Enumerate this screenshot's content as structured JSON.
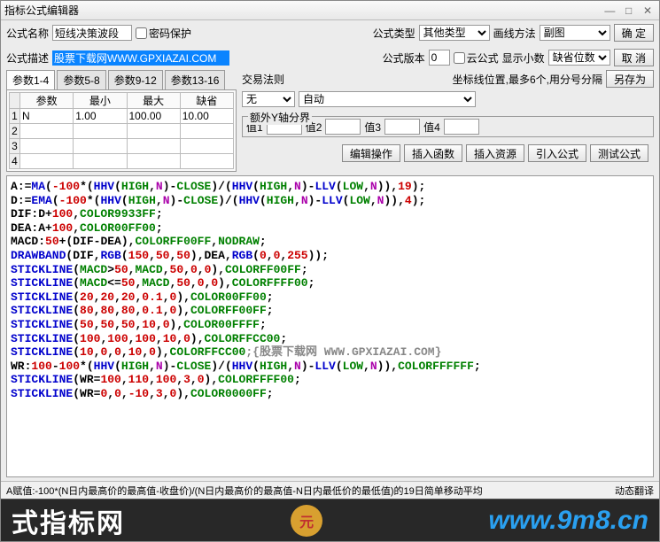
{
  "title": "指标公式编辑器",
  "labels": {
    "name": "公式名称",
    "password": "密码保护",
    "type": "公式类型",
    "drawmethod": "画线方法",
    "ok": "确  定",
    "desc": "公式描述",
    "version": "公式版本",
    "cloud": "云公式",
    "showdec": "显示小数",
    "cancel": "取  消",
    "saveas": "另存为"
  },
  "form": {
    "name_value": "短线决策波段",
    "desc_value": "股票下载网WWW.GPXIAZAI.COM",
    "type_value": "其他类型",
    "drawmethod_value": "副图",
    "version_value": "0",
    "showdec_value": "缺省位数"
  },
  "tabs": {
    "t1": "参数1-4",
    "t2": "参数5-8",
    "t3": "参数9-12",
    "t4": "参数13-16"
  },
  "paramhead": {
    "c1": "参数",
    "c2": "最小",
    "c3": "最大",
    "c4": "缺省"
  },
  "paramrows": [
    {
      "n": "1",
      "name": "N",
      "min": "1.00",
      "max": "100.00",
      "def": "10.00"
    },
    {
      "n": "2",
      "name": "",
      "min": "",
      "max": "",
      "def": ""
    },
    {
      "n": "3",
      "name": "",
      "min": "",
      "max": "",
      "def": ""
    },
    {
      "n": "4",
      "name": "",
      "min": "",
      "max": "",
      "def": ""
    }
  ],
  "right": {
    "tradelaw": "交易法则",
    "coordnote": "坐标线位置,最多6个,用分号分隔",
    "tradelaw_val": "无",
    "auto_val": "自动",
    "extraaxis": "额外Y轴分界",
    "v1": "值1",
    "v2": "值2",
    "v3": "值3",
    "v4": "值4"
  },
  "btns": {
    "edit": "编辑操作",
    "insfunc": "插入函数",
    "insres": "插入资源",
    "import": "引入公式",
    "test": "测试公式"
  },
  "status": {
    "left": "A赋值:-100*(N日内最高价的最高值-收盘价)/(N日内最高价的最高值-N日内最低价的最低值)的19日简单移动平均",
    "right": "动态翻译"
  },
  "watermark": {
    "left": "式指标网",
    "url": "www.9m8.cn"
  },
  "code": [
    [
      [
        "A",
        ""
      ],
      [
        ":=",
        ""
      ],
      [
        "MA",
        "blue"
      ],
      [
        "(",
        ""
      ],
      [
        "-100",
        "red"
      ],
      [
        "*(",
        ""
      ],
      [
        "HHV",
        "blue"
      ],
      [
        "(",
        ""
      ],
      [
        "HIGH",
        "green"
      ],
      [
        ",",
        ""
      ],
      [
        "N",
        "mag"
      ],
      [
        ")-",
        ""
      ],
      [
        "CLOSE",
        "green"
      ],
      [
        ")/(",
        ""
      ],
      [
        "HHV",
        "blue"
      ],
      [
        "(",
        ""
      ],
      [
        "HIGH",
        "green"
      ],
      [
        ",",
        ""
      ],
      [
        "N",
        "mag"
      ],
      [
        ")-",
        ""
      ],
      [
        "LLV",
        "blue"
      ],
      [
        "(",
        ""
      ],
      [
        "LOW",
        "green"
      ],
      [
        ",",
        ""
      ],
      [
        "N",
        "mag"
      ],
      [
        ")),",
        ""
      ],
      [
        "19",
        "red"
      ],
      [
        ");",
        ""
      ]
    ],
    [
      [
        "D",
        ""
      ],
      [
        ":=",
        ""
      ],
      [
        "EMA",
        "blue"
      ],
      [
        "(",
        ""
      ],
      [
        "-100",
        "red"
      ],
      [
        "*(",
        ""
      ],
      [
        "HHV",
        "blue"
      ],
      [
        "(",
        ""
      ],
      [
        "HIGH",
        "green"
      ],
      [
        ",",
        ""
      ],
      [
        "N",
        "mag"
      ],
      [
        ")-",
        ""
      ],
      [
        "CLOSE",
        "green"
      ],
      [
        ")/(",
        ""
      ],
      [
        "HHV",
        "blue"
      ],
      [
        "(",
        ""
      ],
      [
        "HIGH",
        "green"
      ],
      [
        ",",
        ""
      ],
      [
        "N",
        "mag"
      ],
      [
        ")-",
        ""
      ],
      [
        "LLV",
        "blue"
      ],
      [
        "(",
        ""
      ],
      [
        "LOW",
        "green"
      ],
      [
        ",",
        ""
      ],
      [
        "N",
        "mag"
      ],
      [
        ")),",
        ""
      ],
      [
        "4",
        "red"
      ],
      [
        ");",
        ""
      ]
    ],
    [
      [
        "DIF",
        ""
      ],
      [
        ":D+",
        ""
      ],
      [
        "100",
        "red"
      ],
      [
        ",",
        ""
      ],
      [
        "COLOR9933FF",
        "green"
      ],
      [
        ";",
        ""
      ]
    ],
    [
      [
        "DEA",
        ""
      ],
      [
        ":A+",
        ""
      ],
      [
        "100",
        "red"
      ],
      [
        ",",
        ""
      ],
      [
        "COLOR00FF00",
        "green"
      ],
      [
        ";",
        ""
      ]
    ],
    [
      [
        "MACD",
        ""
      ],
      [
        ":",
        ""
      ],
      [
        "50",
        "red"
      ],
      [
        "+(DIF-DEA),",
        ""
      ],
      [
        "COLORFF00FF",
        "green"
      ],
      [
        ",",
        ""
      ],
      [
        "NODRAW",
        "green"
      ],
      [
        ";",
        ""
      ]
    ],
    [
      [
        "DRAWBAND",
        "blue"
      ],
      [
        "(DIF,",
        ""
      ],
      [
        "RGB",
        "blue"
      ],
      [
        "(",
        ""
      ],
      [
        "150",
        "red"
      ],
      [
        ",",
        ""
      ],
      [
        "50",
        "red"
      ],
      [
        ",",
        ""
      ],
      [
        "50",
        "red"
      ],
      [
        "),DEA,",
        ""
      ],
      [
        "RGB",
        "blue"
      ],
      [
        "(",
        ""
      ],
      [
        "0",
        "red"
      ],
      [
        ",",
        ""
      ],
      [
        "0",
        "red"
      ],
      [
        ",",
        ""
      ],
      [
        "255",
        "red"
      ],
      [
        "));",
        ""
      ]
    ],
    [
      [
        "STICKLINE",
        "blue"
      ],
      [
        "(",
        ""
      ],
      [
        "MACD",
        "green"
      ],
      [
        ">",
        ""
      ],
      [
        "50",
        "red"
      ],
      [
        ",",
        ""
      ],
      [
        "MACD",
        "green"
      ],
      [
        ",",
        ""
      ],
      [
        "50",
        "red"
      ],
      [
        ",",
        ""
      ],
      [
        "0",
        "red"
      ],
      [
        ",",
        ""
      ],
      [
        "0",
        "red"
      ],
      [
        "),",
        ""
      ],
      [
        "COLORFF00FF",
        "green"
      ],
      [
        ";",
        ""
      ]
    ],
    [
      [
        "STICKLINE",
        "blue"
      ],
      [
        "(",
        ""
      ],
      [
        "MACD",
        "green"
      ],
      [
        "<=",
        ""
      ],
      [
        "50",
        "red"
      ],
      [
        ",",
        ""
      ],
      [
        "MACD",
        "green"
      ],
      [
        ",",
        ""
      ],
      [
        "50",
        "red"
      ],
      [
        ",",
        ""
      ],
      [
        "0",
        "red"
      ],
      [
        ",",
        ""
      ],
      [
        "0",
        "red"
      ],
      [
        "),",
        ""
      ],
      [
        "COLORFFFF00",
        "green"
      ],
      [
        ";",
        ""
      ]
    ],
    [
      [
        "STICKLINE",
        "blue"
      ],
      [
        "(",
        ""
      ],
      [
        "20",
        "red"
      ],
      [
        ",",
        ""
      ],
      [
        "20",
        "red"
      ],
      [
        ",",
        ""
      ],
      [
        "20",
        "red"
      ],
      [
        ",",
        ""
      ],
      [
        "0.1",
        "red"
      ],
      [
        ",",
        ""
      ],
      [
        "0",
        "red"
      ],
      [
        "),",
        ""
      ],
      [
        "COLOR00FF00",
        "green"
      ],
      [
        ";",
        ""
      ]
    ],
    [
      [
        "STICKLINE",
        "blue"
      ],
      [
        "(",
        ""
      ],
      [
        "80",
        "red"
      ],
      [
        ",",
        ""
      ],
      [
        "80",
        "red"
      ],
      [
        ",",
        ""
      ],
      [
        "80",
        "red"
      ],
      [
        ",",
        ""
      ],
      [
        "0.1",
        "red"
      ],
      [
        ",",
        ""
      ],
      [
        "0",
        "red"
      ],
      [
        "),",
        ""
      ],
      [
        "COLORFF00FF",
        "green"
      ],
      [
        ";",
        ""
      ]
    ],
    [
      [
        "STICKLINE",
        "blue"
      ],
      [
        "(",
        ""
      ],
      [
        "50",
        "red"
      ],
      [
        ",",
        ""
      ],
      [
        "50",
        "red"
      ],
      [
        ",",
        ""
      ],
      [
        "50",
        "red"
      ],
      [
        ",",
        ""
      ],
      [
        "10",
        "red"
      ],
      [
        ",",
        ""
      ],
      [
        "0",
        "red"
      ],
      [
        "),",
        ""
      ],
      [
        "COLOR00FFFF",
        "green"
      ],
      [
        ";",
        ""
      ]
    ],
    [
      [
        "STICKLINE",
        "blue"
      ],
      [
        "(",
        ""
      ],
      [
        "100",
        "red"
      ],
      [
        ",",
        ""
      ],
      [
        "100",
        "red"
      ],
      [
        ",",
        ""
      ],
      [
        "100",
        "red"
      ],
      [
        ",",
        ""
      ],
      [
        "10",
        "red"
      ],
      [
        ",",
        ""
      ],
      [
        "0",
        "red"
      ],
      [
        "),",
        ""
      ],
      [
        "COLORFFCC00",
        "green"
      ],
      [
        ";",
        ""
      ]
    ],
    [
      [
        "STICKLINE",
        "blue"
      ],
      [
        "(",
        ""
      ],
      [
        "10",
        "red"
      ],
      [
        ",",
        ""
      ],
      [
        "0",
        "red"
      ],
      [
        ",",
        ""
      ],
      [
        "0",
        "red"
      ],
      [
        ",",
        ""
      ],
      [
        "10",
        "red"
      ],
      [
        ",",
        ""
      ],
      [
        "0",
        "red"
      ],
      [
        "),",
        ""
      ],
      [
        "COLORFFCC00",
        "green"
      ],
      [
        ";{股票下载网 WWW.GPXIAZAI.COM}",
        "gray"
      ]
    ],
    [
      [
        "WR",
        ""
      ],
      [
        ":",
        ""
      ],
      [
        "100",
        "red"
      ],
      [
        "-",
        ""
      ],
      [
        "100",
        "red"
      ],
      [
        "*(",
        ""
      ],
      [
        "HHV",
        "blue"
      ],
      [
        "(",
        ""
      ],
      [
        "HIGH",
        "green"
      ],
      [
        ",",
        ""
      ],
      [
        "N",
        "mag"
      ],
      [
        ")-",
        ""
      ],
      [
        "CLOSE",
        "green"
      ],
      [
        ")/(",
        ""
      ],
      [
        "HHV",
        "blue"
      ],
      [
        "(",
        ""
      ],
      [
        "HIGH",
        "green"
      ],
      [
        ",",
        ""
      ],
      [
        "N",
        "mag"
      ],
      [
        ")-",
        ""
      ],
      [
        "LLV",
        "blue"
      ],
      [
        "(",
        ""
      ],
      [
        "LOW",
        "green"
      ],
      [
        ",",
        ""
      ],
      [
        "N",
        "mag"
      ],
      [
        ")),",
        ""
      ],
      [
        "COLORFFFFFF",
        "green"
      ],
      [
        ";",
        ""
      ]
    ],
    [
      [
        "STICKLINE",
        "blue"
      ],
      [
        "(WR=",
        ""
      ],
      [
        "100",
        "red"
      ],
      [
        ",",
        ""
      ],
      [
        "110",
        "red"
      ],
      [
        ",",
        ""
      ],
      [
        "100",
        "red"
      ],
      [
        ",",
        ""
      ],
      [
        "3",
        "red"
      ],
      [
        ",",
        ""
      ],
      [
        "0",
        "red"
      ],
      [
        "),",
        ""
      ],
      [
        "COLORFFFF00",
        "green"
      ],
      [
        ";",
        ""
      ]
    ],
    [
      [
        "STICKLINE",
        "blue"
      ],
      [
        "(WR=",
        ""
      ],
      [
        "0",
        "red"
      ],
      [
        ",",
        ""
      ],
      [
        "0",
        "red"
      ],
      [
        ",",
        ""
      ],
      [
        "-10",
        "red"
      ],
      [
        ",",
        ""
      ],
      [
        "3",
        "red"
      ],
      [
        ",",
        ""
      ],
      [
        "0",
        "red"
      ],
      [
        "),",
        ""
      ],
      [
        "COLOR0000FF",
        "green"
      ],
      [
        ";",
        ""
      ]
    ]
  ]
}
